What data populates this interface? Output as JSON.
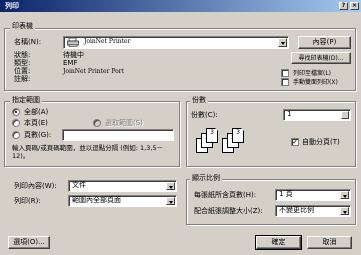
{
  "title": "列印",
  "title_buttons": {
    "help": "?",
    "close": "×"
  },
  "printer": {
    "group_label": "印表機",
    "name_label": "名稱(N):",
    "name_value": "JoinNet Printer",
    "properties_button": "內容(P)",
    "find_button": "尋找印表機(D)...",
    "status_label": "狀態:",
    "status_value": "待機中",
    "type_label": "類型:",
    "type_value": "EMF",
    "where_label": "位置:",
    "where_value": "JoinNet Printer Port",
    "comment_label": "註解:",
    "print_to_file": "列印至檔案(L)",
    "manual_duplex": "手動雙面列印(X)"
  },
  "page_range": {
    "group_label": "指定範圍",
    "all": "全部(A)",
    "current": "本頁(E)",
    "selection": "選取範圍(S)",
    "pages": "頁數(G):",
    "pages_value": "",
    "hint": "輸入頁碼/或頁碼範圍，並以逗點分隔 (例如: 1,3,5－12)。"
  },
  "copies": {
    "group_label": "份數",
    "number_label": "份數(C):",
    "number_value": "1",
    "collate": "自動分頁(T)",
    "collate_checked": true,
    "page_icons": [
      "1",
      "2",
      "3",
      "1",
      "2",
      "3"
    ]
  },
  "print_what": {
    "label": "列印內容(W):",
    "value": "文件"
  },
  "print": {
    "label": "列印(R):",
    "value": "範圍內全部頁面"
  },
  "zoom": {
    "group_label": "顯示比例",
    "pages_per_sheet_label": "每張紙所含頁數(H):",
    "pages_per_sheet_value": "1 頁",
    "scale_label": "配合紙張調整大小(Z):",
    "scale_value": "不變更比例"
  },
  "footer": {
    "options": "選項(O)...",
    "ok": "確定",
    "cancel": "取消"
  }
}
